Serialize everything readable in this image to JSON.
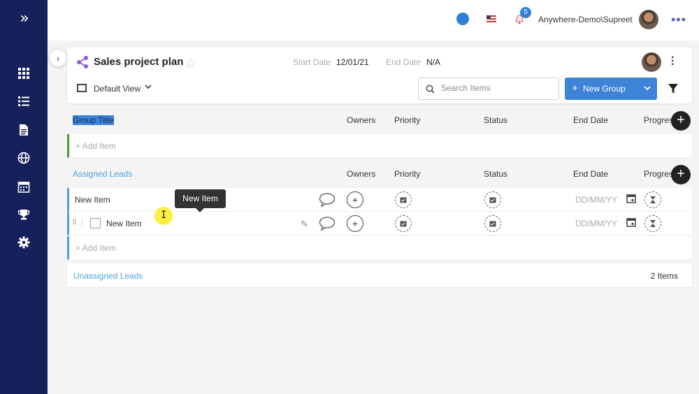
{
  "header": {
    "user_name": "Anywhere-Demo\\Supreet",
    "notification_count": "5",
    "icons": [
      "status-icon",
      "us-flag-icon",
      "bell-icon",
      "more-icon"
    ]
  },
  "sidebar": {
    "items": [
      "dashboard-icon",
      "list-icon",
      "document-icon",
      "globe-icon",
      "calendar-icon",
      "trophy-icon",
      "settings-icon"
    ]
  },
  "plan": {
    "title": "Sales project plan",
    "start_label": "Start Date",
    "start_value": "12/01/21",
    "end_label": "End Date",
    "end_value": "N/A",
    "view_label": "Default View",
    "search_placeholder": "Search Items",
    "new_group_label": "New Group"
  },
  "columns": {
    "owners": "Owners",
    "priority": "Priority",
    "status": "Status",
    "end_date": "End Date",
    "progress": "Progres"
  },
  "groups": {
    "group1": {
      "title": "Group Title",
      "add_item": "+ Add Item"
    },
    "assigned": {
      "title": "Assigned Leads",
      "items": [
        {
          "name": "New Item",
          "date_placeholder": "DD/MM/YY"
        },
        {
          "name": "New Item",
          "date_placeholder": "DD/MM/YY"
        }
      ],
      "add_item": "+ Add Item"
    },
    "unassigned": {
      "title": "Unassigned Leads",
      "count": "2 Items"
    }
  },
  "tooltip": {
    "text": "New Item"
  }
}
